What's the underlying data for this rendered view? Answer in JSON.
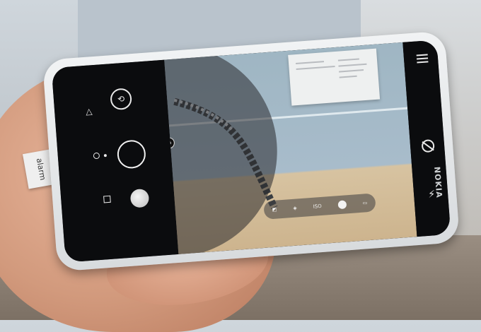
{
  "camera": {
    "dial_label": "m",
    "iso_label": "ISO",
    "brand": "NOKIA"
  },
  "tag": {
    "text": "alarm"
  },
  "icons": {
    "switch_camera": "switch-camera-icon",
    "menu": "menu-icon",
    "flash": "flash-icon",
    "timer": "timer-off-icon",
    "shutter": "shutter-button",
    "gallery": "gallery-thumbnail"
  }
}
